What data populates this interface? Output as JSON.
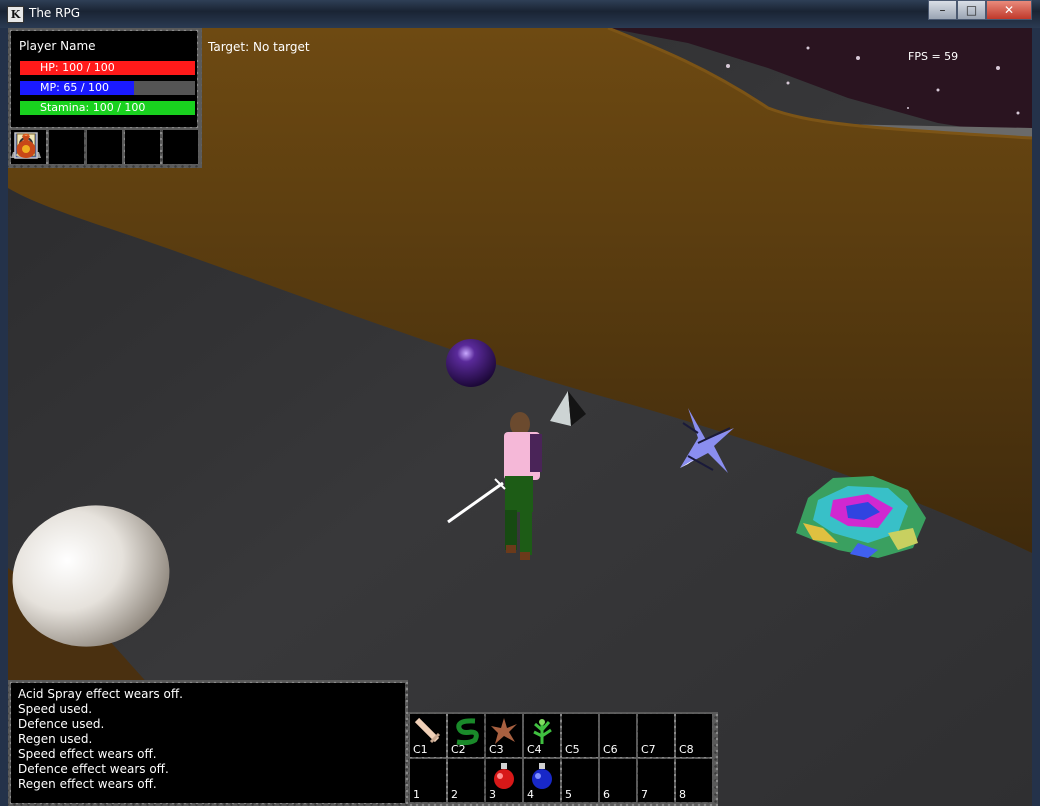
{
  "window": {
    "title": "The RPG",
    "app_icon": "rpg-app-icon",
    "buttons": [
      "minimize",
      "maximize",
      "close"
    ]
  },
  "status": {
    "player_name": "Player Name",
    "hp": {
      "label": "HP: 100 / 100",
      "value": 100,
      "max": 100,
      "color": "#ff1a1a"
    },
    "mp": {
      "label": "MP: 65 / 100",
      "value": 65,
      "max": 100,
      "color": "#1a1aff"
    },
    "stamina": {
      "label": "Stamina: 100 / 100",
      "value": 100,
      "max": 100,
      "color": "#19d11f"
    }
  },
  "menu": [
    {
      "name": "computer-icon"
    },
    {
      "name": "character-icon"
    },
    {
      "name": "spellbook-icon"
    },
    {
      "name": "quest-scroll-icon"
    },
    {
      "name": "inventory-bag-icon"
    }
  ],
  "target": {
    "text": "Target: No target"
  },
  "fps": {
    "text": "FPS = 59"
  },
  "chat": {
    "lines": [
      "Acid Spray effect wears off.",
      "Speed used.",
      "Defence used.",
      "Regen used.",
      "Speed effect wears off.",
      "Defence effect wears off.",
      "Regen effect wears off."
    ]
  },
  "actionbar": {
    "combat": [
      {
        "key": "C1",
        "icon": "sword-icon"
      },
      {
        "key": "C2",
        "icon": "acid-spray-icon"
      },
      {
        "key": "C3",
        "icon": "speed-icon"
      },
      {
        "key": "C4",
        "icon": "regen-icon"
      },
      {
        "key": "C5",
        "icon": ""
      },
      {
        "key": "C6",
        "icon": ""
      },
      {
        "key": "C7",
        "icon": ""
      },
      {
        "key": "C8",
        "icon": ""
      }
    ],
    "items": [
      {
        "key": "1",
        "icon": ""
      },
      {
        "key": "2",
        "icon": ""
      },
      {
        "key": "3",
        "icon": "red-potion-icon"
      },
      {
        "key": "4",
        "icon": "blue-potion-icon"
      },
      {
        "key": "5",
        "icon": ""
      },
      {
        "key": "6",
        "icon": ""
      },
      {
        "key": "7",
        "icon": ""
      },
      {
        "key": "8",
        "icon": ""
      }
    ]
  }
}
